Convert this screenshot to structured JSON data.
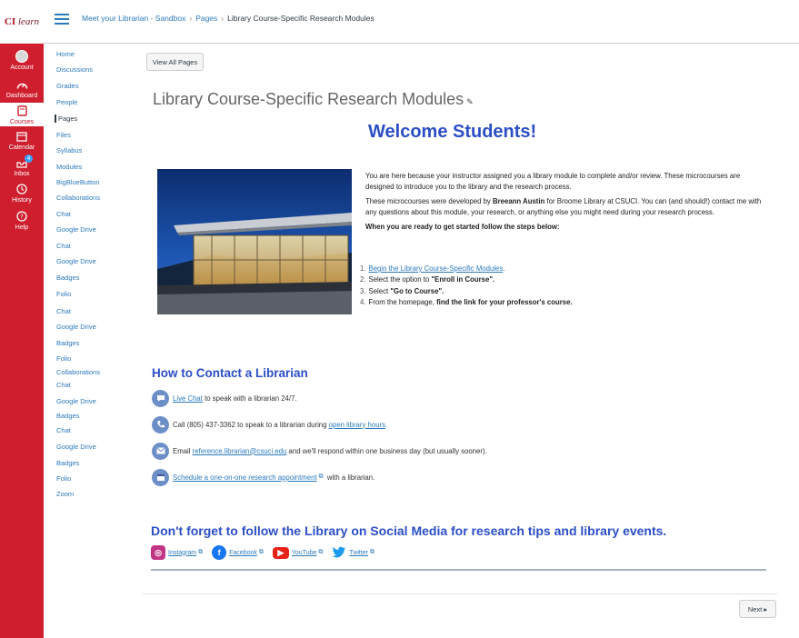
{
  "global_nav": {
    "logo_brand": "CI",
    "logo_word": "learn",
    "items": [
      {
        "label": "Account",
        "icon": "user-icon"
      },
      {
        "label": "Dashboard",
        "icon": "dashboard-icon"
      },
      {
        "label": "Courses",
        "icon": "book-icon"
      },
      {
        "label": "Calendar",
        "icon": "calendar-icon"
      },
      {
        "label": "Inbox",
        "icon": "inbox-icon",
        "badge": "4"
      },
      {
        "label": "History",
        "icon": "clock-icon"
      },
      {
        "label": "Help",
        "icon": "help-icon"
      }
    ]
  },
  "breadcrumb": {
    "course": "Meet your Librarian - Sandbox",
    "section": "Pages",
    "current": "Library Course-Specific Research Modules"
  },
  "course_nav": [
    "Home",
    "Discussions",
    "Grades",
    "People",
    "Pages",
    "Files",
    "Syllabus",
    "Modules",
    "BigBlueButton",
    "Collaborations",
    "Chat",
    "Google Drive",
    "Chat",
    "Google Drive",
    "Badges",
    "Folio",
    "Chat",
    "Google Drive",
    "Badges",
    "Folio",
    "Collaborations",
    "Chat",
    "Google Drive",
    "Badges",
    "Chat",
    "Google Drive",
    "Badges",
    "Folio",
    "Zoom"
  ],
  "content": {
    "view_all_pages": "View All Pages",
    "page_title": "Library Course-Specific Research Modules",
    "welcome": "Welcome Students!",
    "intro_p1": "You are here because your instructor assigned you a library module to complete and/or review. These microcourses are designed to introduce you to the library and the research process.",
    "intro_p2_a": "These microcourses were developed by ",
    "intro_p2_name": "Breeann Austin",
    "intro_p2_b": " for Broome Library at CSUCI. You can (and should!) contact me with any questions about this module, your research, or anything else you might need during your research process.",
    "steps_heading": "When you are ready to get started follow the steps below:",
    "step1_link": "Begin the Library Course-Specific Modules",
    "step1_end": ".",
    "step2_a": "Select the option to ",
    "step2_b": "\"Enroll in Course\".",
    "step3_a": "Select ",
    "step3_b": "\"Go to Course\".",
    "step4_a": "From the homepage, ",
    "step4_b": "find the link for your professor's course."
  },
  "contact": {
    "heading": "How to Contact a Librarian",
    "live_chat_link": "Live Chat",
    "live_chat_text": " to speak with a librarian 24/7.",
    "call_text": "Call (805) 437-3362 to speak to a librarian during ",
    "call_link": "open library hours",
    "call_end": ".",
    "email_text": "Email ",
    "email_link": "reference.librarian@csuci.edu",
    "email_end": " and we'll respond within one business day (but usually sooner).",
    "schedule_link": "Schedule a one-on-one research appointment",
    "schedule_end": " with a librarian."
  },
  "social": {
    "heading": "Don't forget to follow the Library on Social Media for research tips and library events.",
    "links": [
      "Instagram",
      "Facebook",
      "YouTube",
      "Twitter"
    ]
  },
  "footer": {
    "next_label": "Next ▸"
  }
}
